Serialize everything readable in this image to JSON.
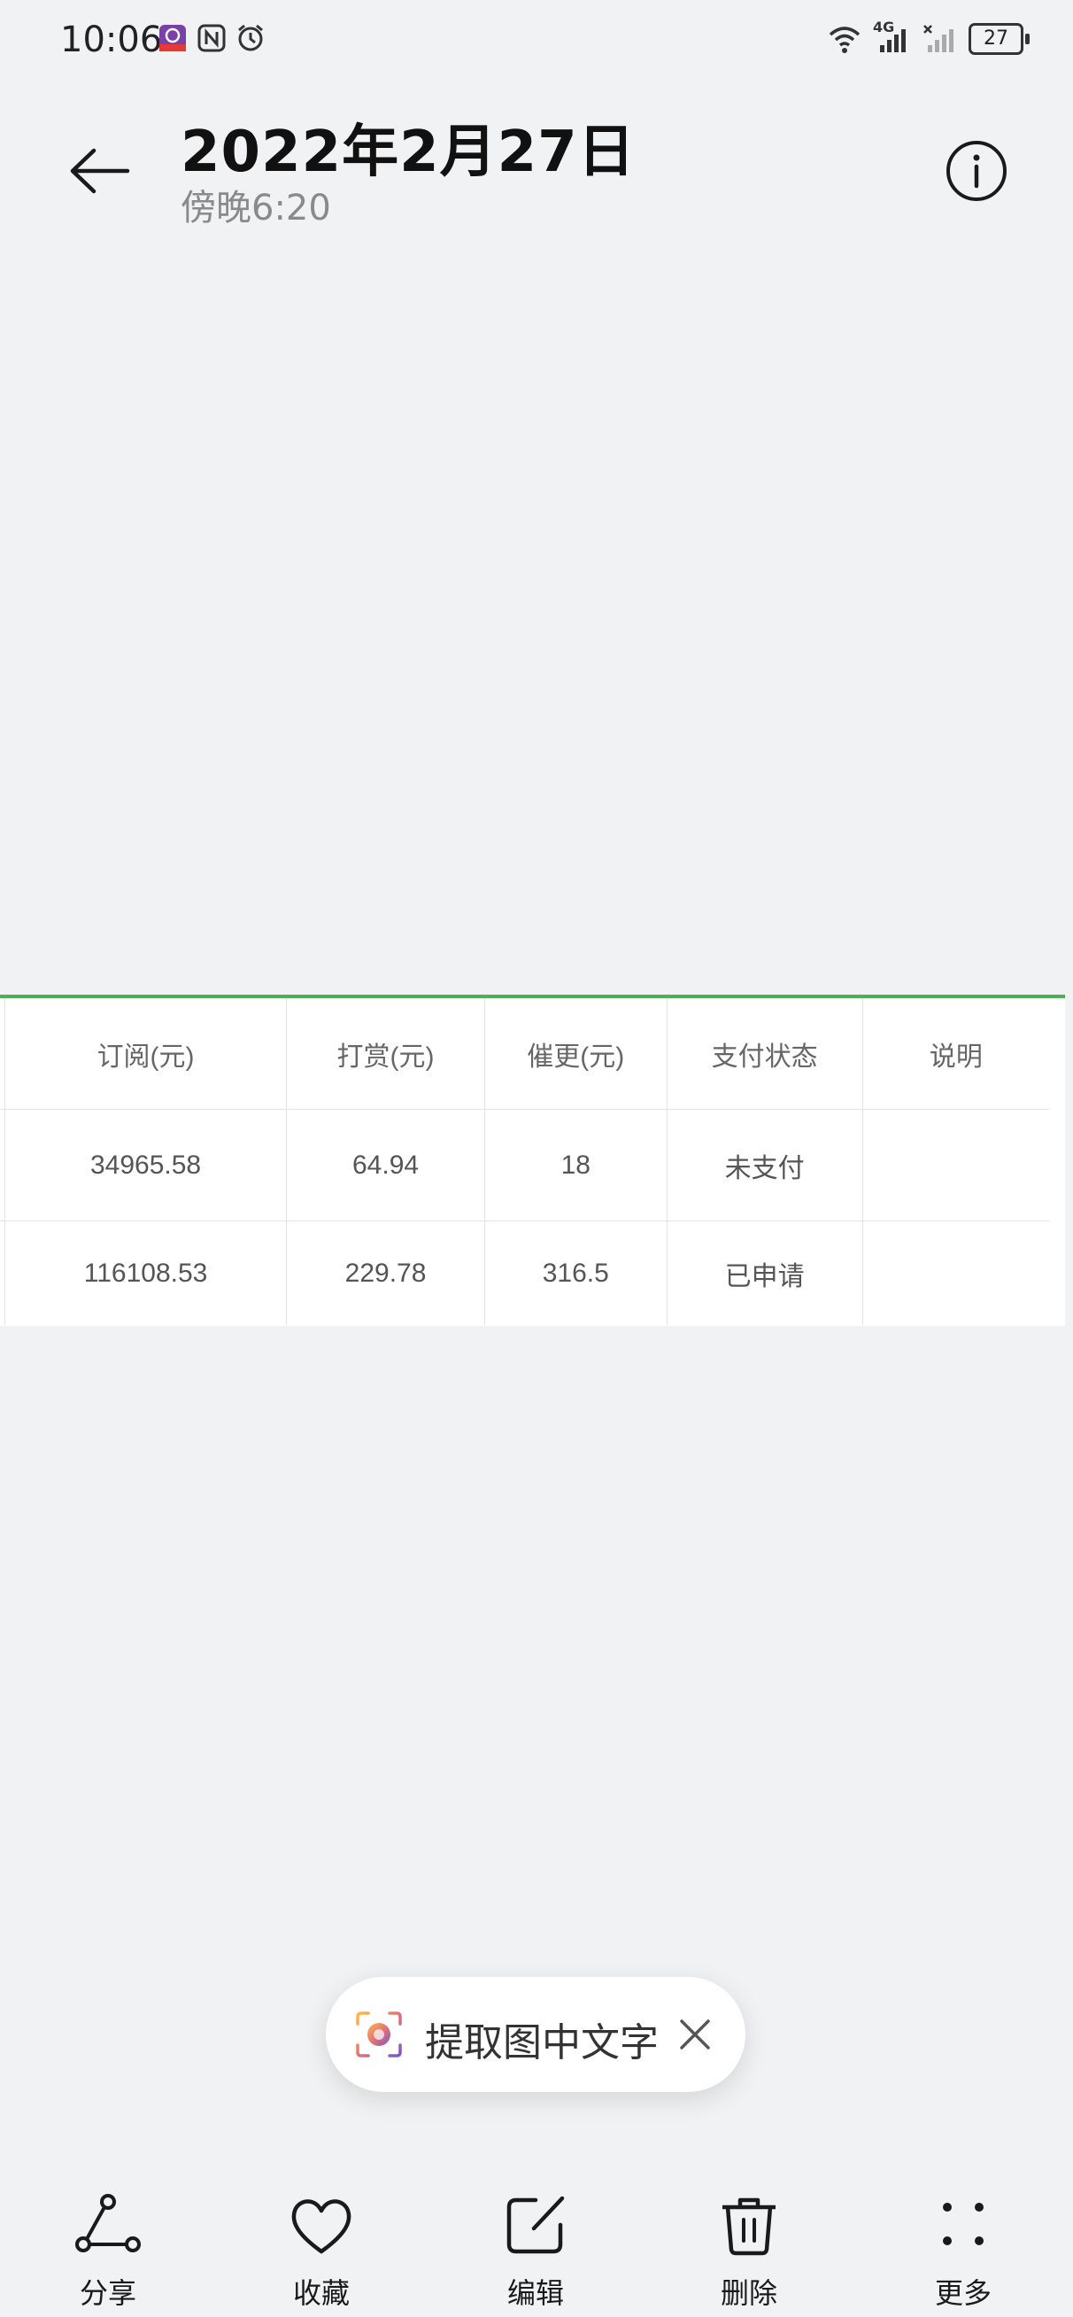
{
  "status_bar": {
    "time": "10:06",
    "network": "4G",
    "battery": "27",
    "icons": [
      "app-badge-icon",
      "nfc-icon",
      "alarm-icon",
      "wifi-icon",
      "signal-icon",
      "signal-no-sim-icon",
      "battery-icon"
    ]
  },
  "header": {
    "title": "2022年2月27日",
    "subtitle": "傍晚6:20",
    "back_icon": "back-arrow-icon",
    "info_icon": "info-icon"
  },
  "table": {
    "columns": [
      "订阅(元)",
      "打赏(元)",
      "催更(元)",
      "支付状态",
      "说明"
    ],
    "rows": [
      [
        "34965.58",
        "64.94",
        "18",
        "未支付",
        ""
      ],
      [
        "116108.53",
        "229.78",
        "316.5",
        "已申请",
        ""
      ]
    ],
    "accent_color": "#4caf50"
  },
  "ocr_pill": {
    "label": "提取图中文字",
    "icon": "scan-text-icon",
    "close_icon": "close-icon"
  },
  "bottom_bar": {
    "items": [
      {
        "label": "分享",
        "icon": "share-icon"
      },
      {
        "label": "收藏",
        "icon": "heart-icon"
      },
      {
        "label": "编辑",
        "icon": "edit-icon"
      },
      {
        "label": "删除",
        "icon": "trash-icon"
      },
      {
        "label": "更多",
        "icon": "more-icon"
      }
    ]
  }
}
